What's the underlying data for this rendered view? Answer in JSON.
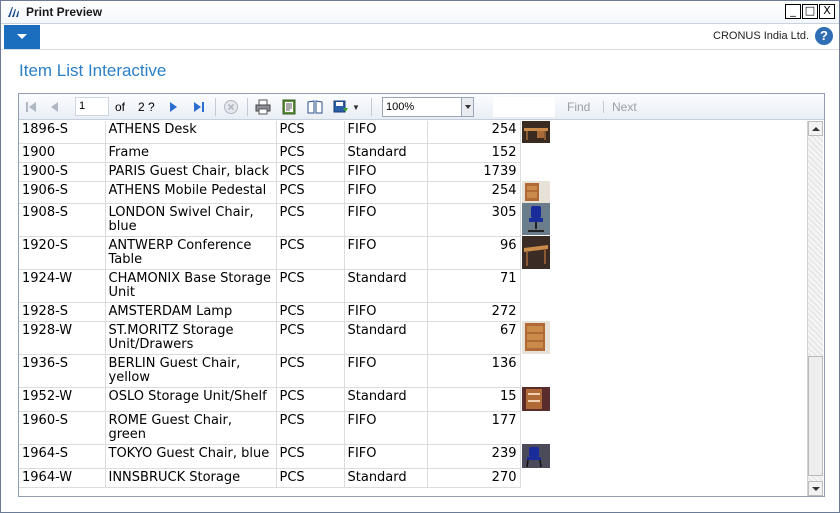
{
  "window": {
    "title": "Print Preview",
    "controls": {
      "minimize": "_",
      "maximize": "□",
      "close": "X"
    }
  },
  "ribbon": {
    "company": "CRONUS India Ltd.",
    "help": "?"
  },
  "page_title": "Item List Interactive",
  "toolbar": {
    "current_page": "1",
    "of_label": "of",
    "total_pages": "2 ?",
    "zoom": "100%",
    "find_placeholder": "",
    "find_label": "Find",
    "next_label": "Next",
    "icons": [
      "first-page-icon",
      "previous-page-icon",
      "next-page-icon",
      "last-page-icon",
      "stop-icon",
      "print-icon",
      "page-setup-icon",
      "print-layout-icon",
      "export-icon"
    ]
  },
  "rows": [
    {
      "no": "1896-S",
      "desc": [
        "ATHENS Desk"
      ],
      "uom": "PCS",
      "costing": "FIFO",
      "inventory": "254",
      "picture": "desk-picture"
    },
    {
      "no": "1900",
      "desc": [
        "Frame"
      ],
      "uom": "PCS",
      "costing": "Standard",
      "inventory": "152",
      "picture": ""
    },
    {
      "no": "1900-S",
      "desc": [
        "PARIS Guest Chair, black"
      ],
      "uom": "PCS",
      "costing": "FIFO",
      "inventory": "1739",
      "picture": ""
    },
    {
      "no": "1906-S",
      "desc": [
        "ATHENS Mobile Pedestal"
      ],
      "uom": "PCS",
      "costing": "FIFO",
      "inventory": "254",
      "picture": "pedestal-picture"
    },
    {
      "no": "1908-S",
      "desc": [
        "LONDON Swivel Chair,",
        "blue"
      ],
      "uom": "PCS",
      "costing": "FIFO",
      "inventory": "305",
      "picture": "swivel-chair-picture"
    },
    {
      "no": "1920-S",
      "desc": [
        "ANTWERP Conference",
        "Table"
      ],
      "uom": "PCS",
      "costing": "FIFO",
      "inventory": "96",
      "picture": "table-picture"
    },
    {
      "no": "1924-W",
      "desc": [
        "CHAMONIX Base Storage",
        "Unit"
      ],
      "uom": "PCS",
      "costing": "Standard",
      "inventory": "71",
      "picture": ""
    },
    {
      "no": "1928-S",
      "desc": [
        "AMSTERDAM Lamp"
      ],
      "uom": "PCS",
      "costing": "FIFO",
      "inventory": "272",
      "picture": ""
    },
    {
      "no": "1928-W",
      "desc": [
        "ST.MORITZ Storage",
        "Unit/Drawers"
      ],
      "uom": "PCS",
      "costing": "Standard",
      "inventory": "67",
      "picture": "drawers-picture"
    },
    {
      "no": "1936-S",
      "desc": [
        "BERLIN Guest Chair,",
        "yellow"
      ],
      "uom": "PCS",
      "costing": "FIFO",
      "inventory": "136",
      "picture": ""
    },
    {
      "no": "1952-W",
      "desc": [
        "OSLO Storage Unit/Shelf"
      ],
      "uom": "PCS",
      "costing": "Standard",
      "inventory": "15",
      "picture": "shelf-picture"
    },
    {
      "no": "1960-S",
      "desc": [
        "ROME Guest Chair, green"
      ],
      "uom": "PCS",
      "costing": "FIFO",
      "inventory": "177",
      "picture": ""
    },
    {
      "no": "1964-S",
      "desc": [
        "TOKYO Guest Chair, blue"
      ],
      "uom": "PCS",
      "costing": "FIFO",
      "inventory": "239",
      "picture": "guest-chair-picture"
    },
    {
      "no": "1964-W",
      "desc": [
        "INNSBRUCK Storage"
      ],
      "uom": "PCS",
      "costing": "Standard",
      "inventory": "270",
      "picture": ""
    }
  ],
  "colors": {
    "accent": "#1a6ebd",
    "title_blue": "#2a7fc7"
  }
}
